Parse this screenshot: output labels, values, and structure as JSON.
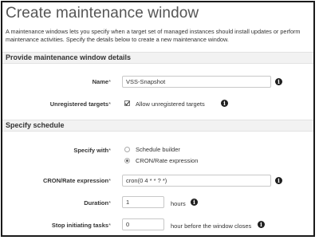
{
  "page": {
    "title": "Create maintenance window",
    "description_line1": "A maintenance windows lets you specify when a target set of managed instances should install updates or perform",
    "description_line2": "maintenance activities. Specify the details below to create a new maintenance window."
  },
  "details_section": {
    "header": "Provide maintenance window details",
    "name": {
      "label": "Name",
      "required_mark": "*",
      "value": "VSS-Snapshot"
    },
    "unregistered_targets": {
      "label": "Unregistered targets",
      "required_mark": "*",
      "checkbox_label": "Allow unregistered targets",
      "checked": true
    }
  },
  "schedule_section": {
    "header": "Specify schedule",
    "specify_with": {
      "label": "Specify with",
      "required_mark": "*",
      "options": [
        {
          "label": "Schedule builder",
          "selected": false
        },
        {
          "label": "CRON/Rate expression",
          "selected": true
        }
      ]
    },
    "cron": {
      "label": "CRON/Rate expression",
      "required_mark": "*",
      "value": "cron(0 4 * * ? *)"
    },
    "duration": {
      "label": "Duration",
      "required_mark": "*",
      "value": "1",
      "unit": "hours"
    },
    "stop_initiating": {
      "label": "Stop initiating tasks",
      "required_mark": "*",
      "value": "0",
      "unit": "hour before the window closes"
    }
  },
  "icons": {
    "info": "i"
  }
}
